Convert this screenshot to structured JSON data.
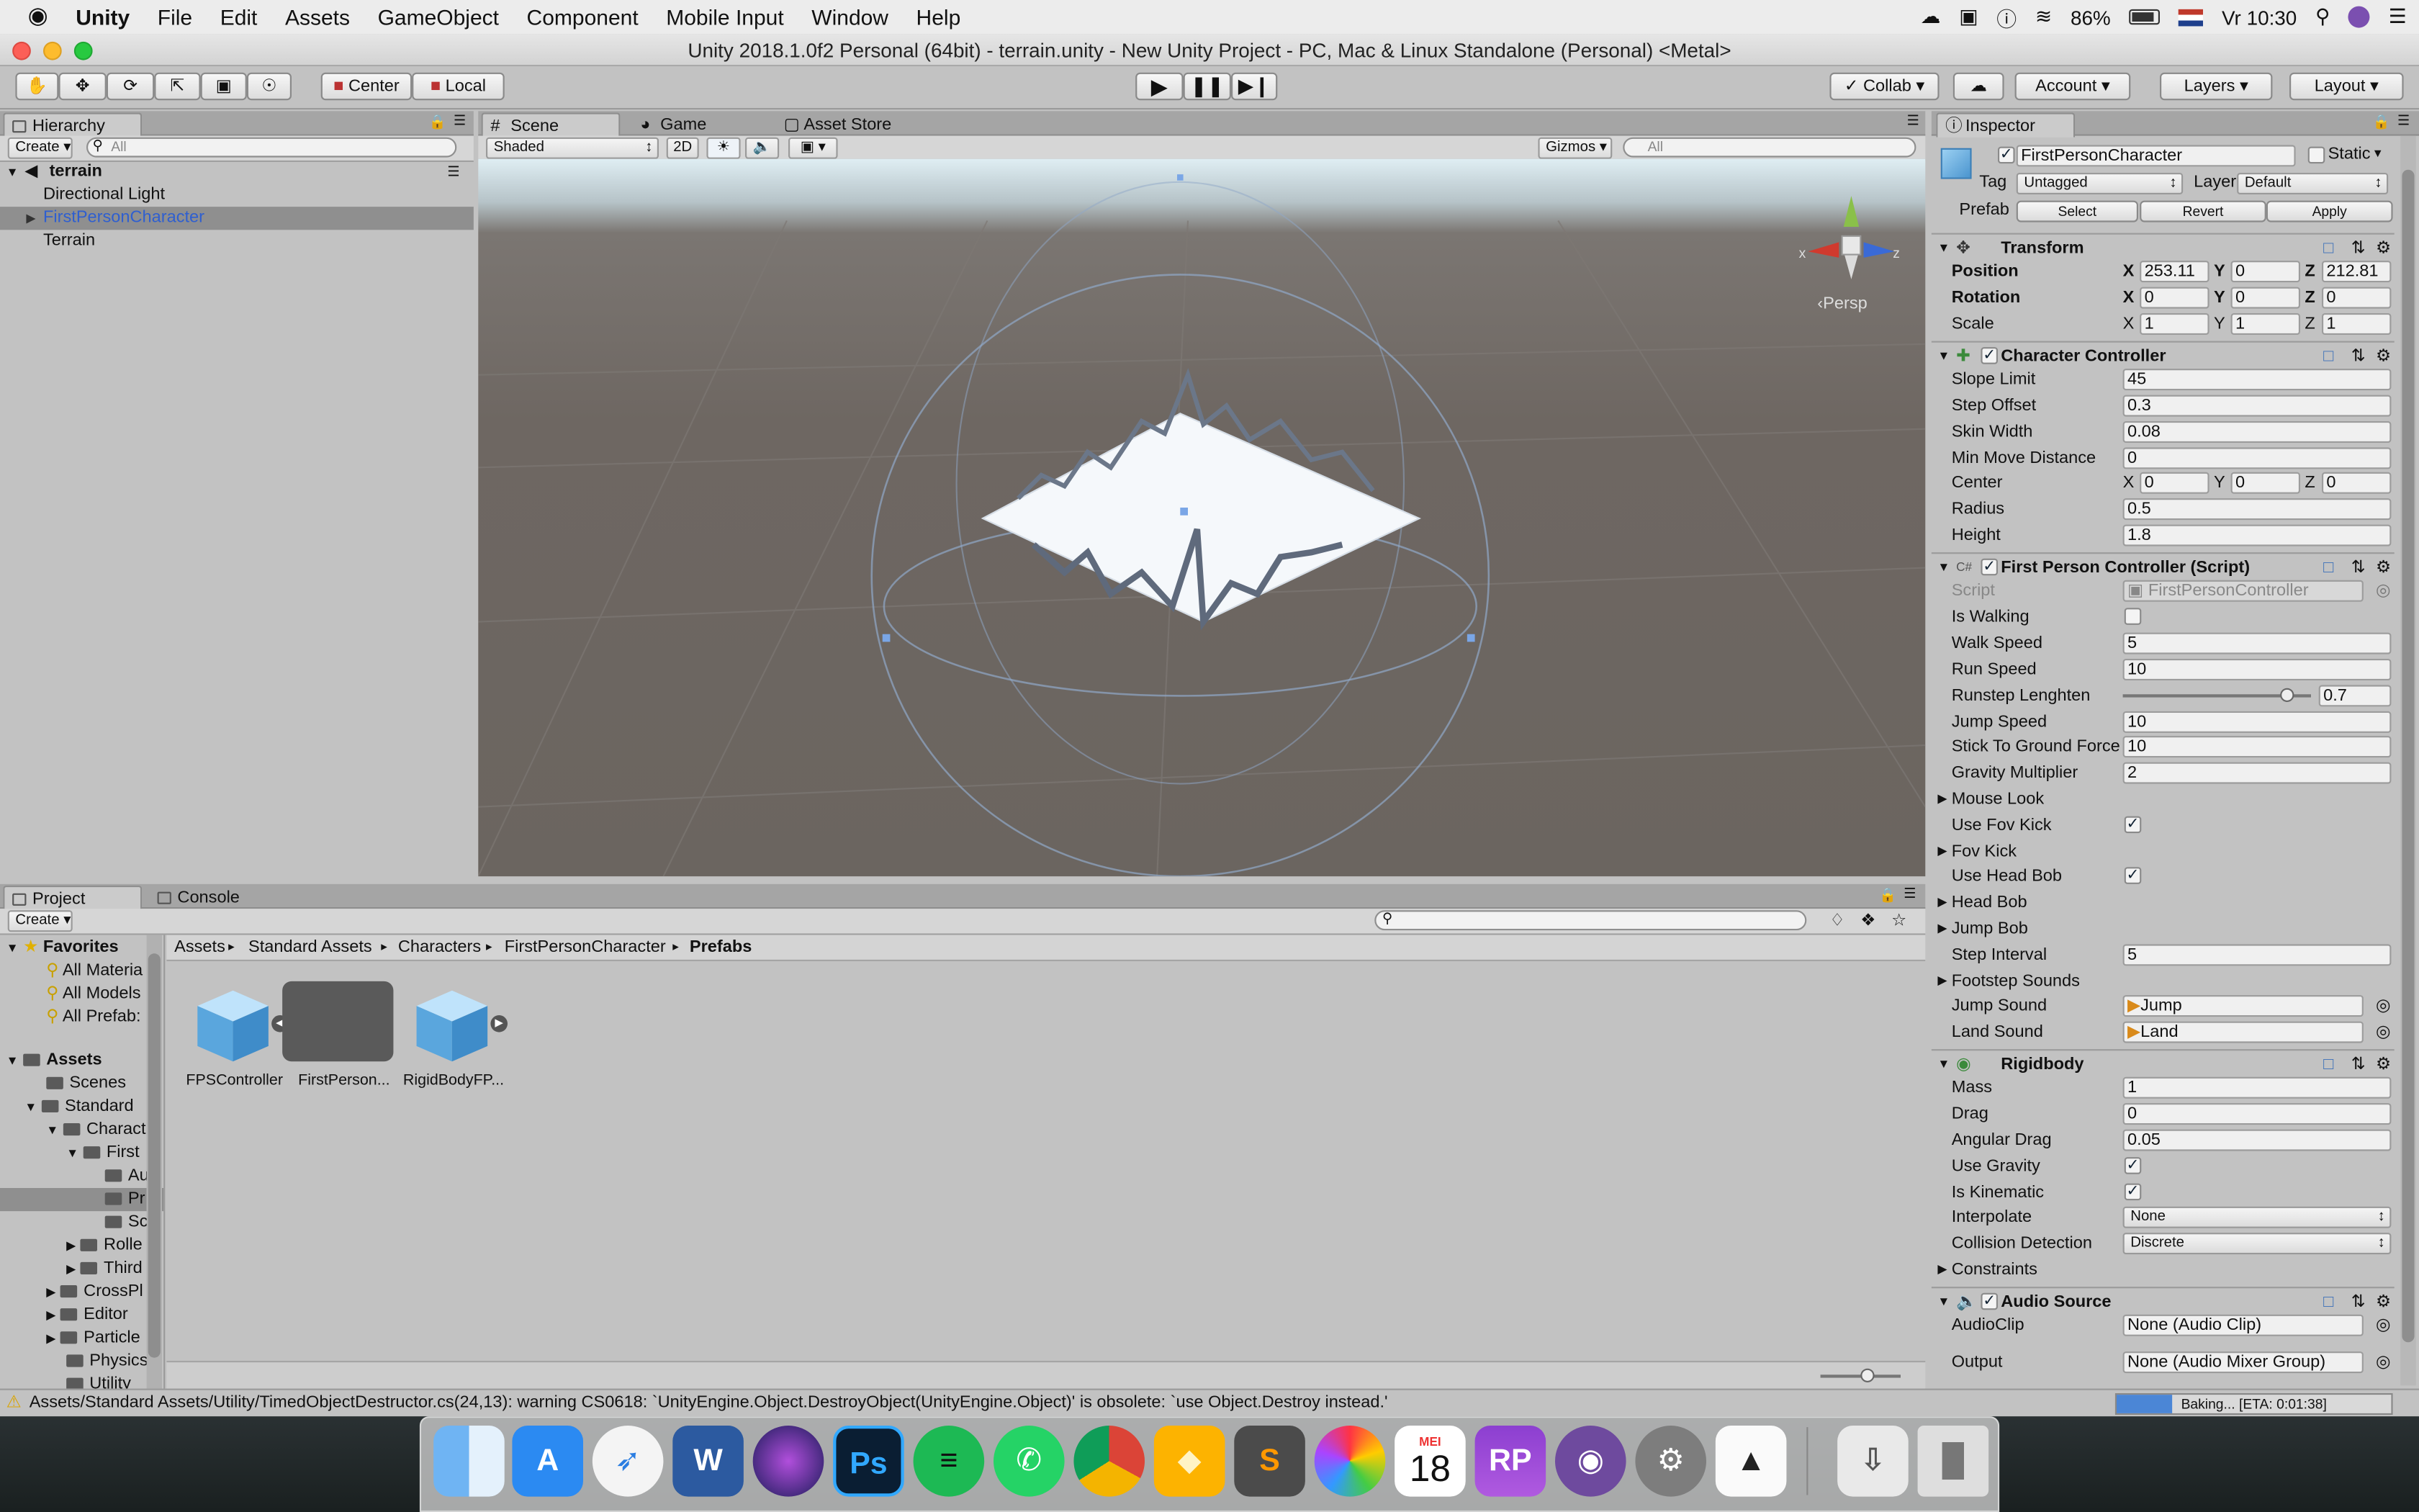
{
  "menubar": {
    "apple": "",
    "items": [
      "Unity",
      "File",
      "Edit",
      "Assets",
      "GameObject",
      "Component",
      "Mobile Input",
      "Window",
      "Help"
    ],
    "battery": "86%",
    "clock": "Vr 10:30"
  },
  "window": {
    "title": "Unity 2018.1.0f2 Personal (64bit) - terrain.unity - New Unity Project - PC, Mac & Linux Standalone (Personal) <Metal>"
  },
  "toolbar": {
    "pivot": "Center",
    "space": "Local",
    "collab": "Collab",
    "account": "Account",
    "layers": "Layers",
    "layout": "Layout"
  },
  "hierarchy": {
    "tab": "Hierarchy",
    "create": "Create",
    "search_placeholder": "All",
    "scene": "terrain",
    "items": [
      "Directional Light",
      "FirstPersonCharacter",
      "Terrain"
    ]
  },
  "scene": {
    "tabs": [
      "Scene",
      "Game",
      "Asset Store"
    ],
    "shading": "Shaded",
    "mode2d": "2D",
    "gizmos": "Gizmos",
    "search_placeholder": "All",
    "persp": "Persp",
    "axis_x": "x",
    "axis_z": "z"
  },
  "inspector": {
    "tab": "Inspector",
    "object_name": "FirstPersonCharacter",
    "static": "Static",
    "tag_label": "Tag",
    "tag": "Untagged",
    "layer_label": "Layer",
    "layer": "Default",
    "prefab_label": "Prefab",
    "prefab_buttons": [
      "Select",
      "Revert",
      "Apply"
    ],
    "transform": {
      "title": "Transform",
      "position_label": "Position",
      "pos": [
        "253.11",
        "0",
        "212.81"
      ],
      "rotation_label": "Rotation",
      "rot": [
        "0",
        "0",
        "0"
      ],
      "scale_label": "Scale",
      "scale": [
        "1",
        "1",
        "1"
      ]
    },
    "cc": {
      "title": "Character Controller",
      "rows": [
        {
          "label": "Slope Limit",
          "value": "45"
        },
        {
          "label": "Step Offset",
          "value": "0.3"
        },
        {
          "label": "Skin Width",
          "value": "0.08"
        },
        {
          "label": "Min Move Distance",
          "value": "0"
        }
      ],
      "center_label": "Center",
      "center": [
        "0",
        "0",
        "0"
      ],
      "radius_label": "Radius",
      "radius": "0.5",
      "height_label": "Height",
      "height": "1.8"
    },
    "fpc": {
      "title": "First Person Controller (Script)",
      "script_label": "Script",
      "script": "FirstPersonController",
      "is_walking": "Is Walking",
      "walk_speed_label": "Walk Speed",
      "walk_speed": "5",
      "run_speed_label": "Run Speed",
      "run_speed": "10",
      "runstep_label": "Runstep Lenghten",
      "runstep": "0.7",
      "runstep_fraction": 0.7,
      "jump_speed_label": "Jump Speed",
      "jump_speed": "10",
      "stick_label": "Stick To Ground Force",
      "stick": "10",
      "gravity_label": "Gravity Multiplier",
      "gravity": "2",
      "mouse_look": "Mouse Look",
      "use_fov_kick": "Use Fov Kick",
      "fov_kick": "Fov Kick",
      "use_head_bob": "Use Head Bob",
      "head_bob": "Head Bob",
      "jump_bob": "Jump Bob",
      "step_interval_label": "Step Interval",
      "step_interval": "5",
      "footstep": "Footstep Sounds",
      "jump_sound_label": "Jump Sound",
      "jump_sound": "Jump",
      "land_sound_label": "Land Sound",
      "land_sound": "Land"
    },
    "rb": {
      "title": "Rigidbody",
      "mass_label": "Mass",
      "mass": "1",
      "drag_label": "Drag",
      "drag": "0",
      "angular_label": "Angular Drag",
      "angular": "0.05",
      "gravity_label": "Use Gravity",
      "kinematic_label": "Is Kinematic",
      "interp_label": "Interpolate",
      "interp": "None",
      "collision_label": "Collision Detection",
      "collision": "Discrete",
      "constraints": "Constraints"
    },
    "audio": {
      "title": "Audio Source",
      "clip_label": "AudioClip",
      "clip": "None (Audio Clip)",
      "output_label": "Output",
      "output": "None (Audio Mixer Group)"
    }
  },
  "project": {
    "tabs": [
      "Project",
      "Console"
    ],
    "create": "Create",
    "favorites": "Favorites",
    "fav_items": [
      "All Materia",
      "All Models",
      "All Prefab:"
    ],
    "assets": "Assets",
    "tree": [
      "Scenes",
      "Standard",
      "Charact",
      "First",
      "Au",
      "Pr",
      "Sc",
      "Rolle",
      "Third",
      "CrossPl",
      "Editor",
      "Particle",
      "Physics",
      "Utility"
    ],
    "breadcrumb": [
      "Assets",
      "Standard Assets",
      "Characters",
      "FirstPersonCharacter",
      "Prefabs"
    ],
    "files": [
      "FPSController",
      "FirstPerson...",
      "RigidBodyFP..."
    ]
  },
  "console": {
    "warning": "Assets/Standard Assets/Utility/TimedObjectDestructor.cs(24,13): warning CS0618: `UnityEngine.Object.DestroyObject(UnityEngine.Object)' is obsolete: `use Object.Destroy instead.'",
    "baking": "Baking... [ETA: 0:01:38]",
    "baking_progress": 0.2
  },
  "dock": {
    "apps": [
      "finder",
      "app-store",
      "safari",
      "word",
      "siri",
      "photoshop",
      "spotify",
      "whatsapp",
      "chrome",
      "sketch",
      "sublime",
      "photos",
      "calendar",
      "rp",
      "github",
      "system-preferences",
      "unity",
      "downloads",
      "trash"
    ],
    "calendar_month": "MEI",
    "calendar_day": "18",
    "ps": "Ps",
    "word": "W",
    "rp": "RP",
    "sublime": "S"
  }
}
